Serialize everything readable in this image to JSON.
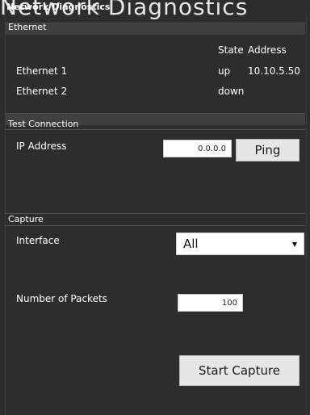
{
  "window": {
    "ghost_title": "Network Diagnostics",
    "title": "Network Diagnostics"
  },
  "ethernet": {
    "section_label": "Ethernet",
    "headers": {
      "state": "State",
      "address": "Address"
    },
    "rows": [
      {
        "name": "Ethernet 1",
        "state": "up",
        "address": "10.10.5.50"
      },
      {
        "name": "Ethernet 2",
        "state": "down",
        "address": ""
      }
    ]
  },
  "test_connection": {
    "section_label": "Test Connection",
    "ip_label": "IP Address",
    "ip_value": "0.0.0.0",
    "ping_label": "Ping"
  },
  "capture": {
    "section_label": "Capture",
    "interface_label": "Interface",
    "interface_selected": "All",
    "packets_label": "Number of Packets",
    "packets_value": "100",
    "start_label": "Start Capture"
  },
  "icons": {
    "dropdown": "chevron-down-icon"
  },
  "colors": {
    "background": "#2d2d2d",
    "section_band": "#404040",
    "text": "#ffffff",
    "button": "#e6e6e6"
  }
}
